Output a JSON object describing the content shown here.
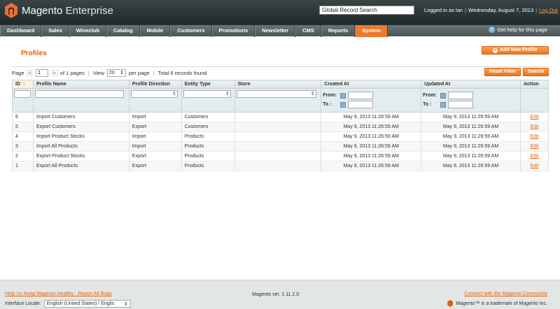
{
  "header": {
    "logo_main": "Magento",
    "logo_sub": "Enterprise",
    "search_value": "Global Record Search",
    "logged_in": "Logged in as lan",
    "date": "Wednesday, August 7, 2013",
    "logout": "Log Out"
  },
  "nav": {
    "items": [
      "Dashboard",
      "Sales",
      "Wineclub",
      "Catalog",
      "Mobile",
      "Customers",
      "Promotions",
      "Newsletter",
      "CMS",
      "Reports",
      "System"
    ],
    "active": "System",
    "help": "Get help for this page"
  },
  "page": {
    "title": "Profiles",
    "add_button": "Add New Profile",
    "reset_button": "Reset Filter",
    "search_button": "Search"
  },
  "pager": {
    "page_label": "Page",
    "page_value": "1",
    "of_pages": "of 1 pages",
    "view_label": "View",
    "per_page_value": "20",
    "per_page_label": "per page",
    "total": "Total 6 records found"
  },
  "table": {
    "headers": [
      "ID",
      "Profile Name",
      "Profile Direction",
      "Entity Type",
      "Store",
      "Created At",
      "Updated At",
      "Action"
    ],
    "from_label": "From:",
    "to_label": "To :",
    "rows": [
      {
        "id": "6",
        "name": "Import Customers",
        "direction": "Import",
        "entity": "Customers",
        "store": "",
        "created": "May 9, 2013 11:26:59 AM",
        "updated": "May 9, 2013 11:26:59 AM",
        "action": "Edit"
      },
      {
        "id": "5",
        "name": "Export Customers",
        "direction": "Export",
        "entity": "Customers",
        "store": "",
        "created": "May 9, 2013 11:26:59 AM",
        "updated": "May 9, 2013 11:26:59 AM",
        "action": "Edit"
      },
      {
        "id": "4",
        "name": "Import Product Stocks",
        "direction": "Import",
        "entity": "Products",
        "store": "",
        "created": "May 9, 2013 11:26:59 AM",
        "updated": "May 9, 2013 11:26:59 AM",
        "action": "Edit"
      },
      {
        "id": "3",
        "name": "Import All Products",
        "direction": "Import",
        "entity": "Products",
        "store": "",
        "created": "May 9, 2013 11:26:59 AM",
        "updated": "May 9, 2013 11:26:59 AM",
        "action": "Edit"
      },
      {
        "id": "2",
        "name": "Export Product Stocks",
        "direction": "Export",
        "entity": "Products",
        "store": "",
        "created": "May 9, 2013 11:26:59 AM",
        "updated": "May 9, 2013 11:26:59 AM",
        "action": "Edit"
      },
      {
        "id": "1",
        "name": "Export All Products",
        "direction": "Export",
        "entity": "Products",
        "store": "",
        "created": "May 9, 2013 11:26:59 AM",
        "updated": "May 9, 2013 11:26:59 AM",
        "action": "Edit"
      }
    ]
  },
  "footer": {
    "help_link": "Help Us Keep Magento Healthy - Report All Bugs",
    "locale_label": "Interface Locale:",
    "locale_value": "English (United States) / Englis",
    "version": "Magento ver. 1.11.2.0",
    "community": "Connect with the Magento Community",
    "trademark": "Magento™ is a trademark of Magento Inc."
  },
  "colors": {
    "accent": "#eb5e00",
    "header": "#2a3436",
    "nav": "#5a6366"
  }
}
